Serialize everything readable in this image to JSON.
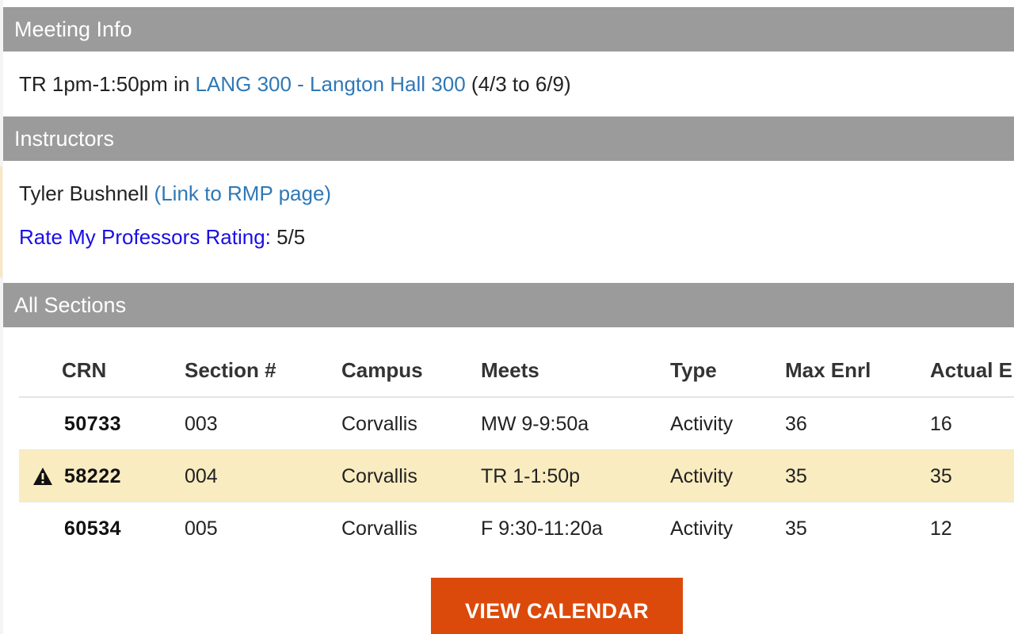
{
  "meeting_info": {
    "header": "Meeting Info",
    "schedule": "TR 1pm-1:50pm in",
    "location_link": "LANG 300 - Langton Hall 300",
    "date_range": "(4/3 to 6/9)"
  },
  "instructors": {
    "header": "Instructors",
    "name": "Tyler Bushnell",
    "rmp_link": "(Link to RMP page)",
    "rating_label": "Rate My Professors Rating:",
    "rating_value": "5/5"
  },
  "all_sections": {
    "header": "All Sections",
    "columns": [
      "CRN",
      "Section #",
      "Campus",
      "Meets",
      "Type",
      "Max Enrl",
      "Actual E"
    ],
    "rows": [
      {
        "crn": "50733",
        "section": "003",
        "campus": "Corvallis",
        "meets": "MW 9-9:50a",
        "type": "Activity",
        "max_enrl": "36",
        "actual_enrl": "16",
        "warning": false
      },
      {
        "crn": "58222",
        "section": "004",
        "campus": "Corvallis",
        "meets": "TR 1-1:50p",
        "type": "Activity",
        "max_enrl": "35",
        "actual_enrl": "35",
        "warning": true
      },
      {
        "crn": "60534",
        "section": "005",
        "campus": "Corvallis",
        "meets": "F 9:30-11:20a",
        "type": "Activity",
        "max_enrl": "35",
        "actual_enrl": "12",
        "warning": false
      }
    ],
    "icons": {
      "warning": "warning-triangle-icon"
    }
  },
  "view_calendar_label": "VIEW CALENDAR",
  "colors": {
    "header_bg": "#9b9b9b",
    "link": "#2f78b7",
    "rmp_label": "#1a0ee6",
    "row_highlight": "#f9ecc0",
    "button": "#db4a0a"
  }
}
